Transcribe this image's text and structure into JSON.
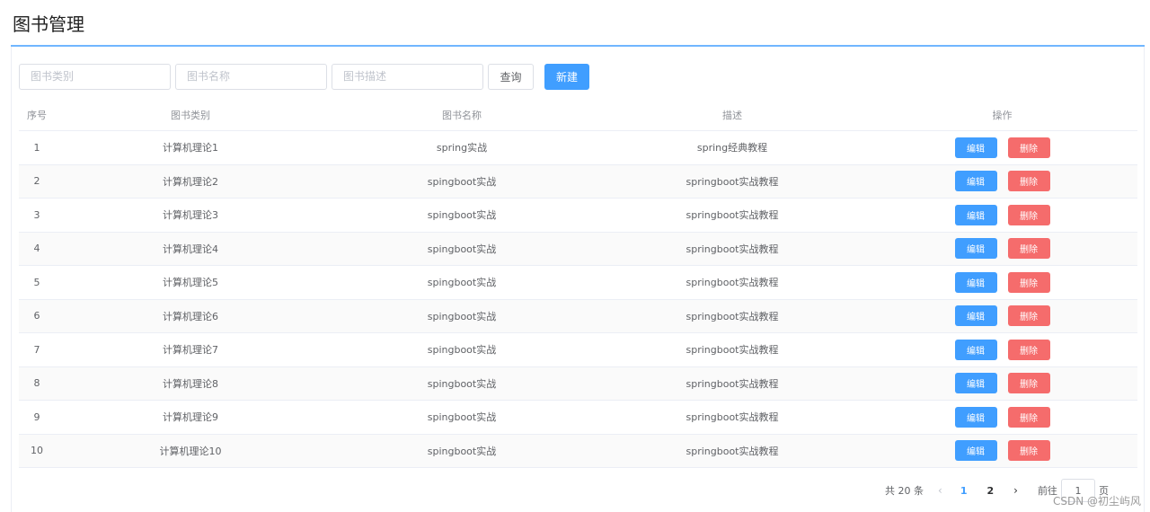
{
  "header": {
    "title": "图书管理"
  },
  "toolbar": {
    "category_placeholder": "图书类别",
    "name_placeholder": "图书名称",
    "desc_placeholder": "图书描述",
    "query_label": "查询",
    "new_label": "新建"
  },
  "table": {
    "columns": [
      "序号",
      "图书类别",
      "图书名称",
      "描述",
      "操作"
    ],
    "rows": [
      {
        "idx": "1",
        "category": "计算机理论1",
        "name": "spring实战",
        "desc": "spring经典教程",
        "edit": "编辑",
        "del": "删除"
      },
      {
        "idx": "2",
        "category": "计算机理论2",
        "name": "spingboot实战",
        "desc": "springboot实战教程",
        "edit": "编辑",
        "del": "删除"
      },
      {
        "idx": "3",
        "category": "计算机理论3",
        "name": "spingboot实战",
        "desc": "springboot实战教程",
        "edit": "编辑",
        "del": "删除"
      },
      {
        "idx": "4",
        "category": "计算机理论4",
        "name": "spingboot实战",
        "desc": "springboot实战教程",
        "edit": "编辑",
        "del": "删除"
      },
      {
        "idx": "5",
        "category": "计算机理论5",
        "name": "spingboot实战",
        "desc": "springboot实战教程",
        "edit": "编辑",
        "del": "删除"
      },
      {
        "idx": "6",
        "category": "计算机理论6",
        "name": "spingboot实战",
        "desc": "springboot实战教程",
        "edit": "编辑",
        "del": "删除"
      },
      {
        "idx": "7",
        "category": "计算机理论7",
        "name": "spingboot实战",
        "desc": "springboot实战教程",
        "edit": "编辑",
        "del": "删除"
      },
      {
        "idx": "8",
        "category": "计算机理论8",
        "name": "spingboot实战",
        "desc": "springboot实战教程",
        "edit": "编辑",
        "del": "删除"
      },
      {
        "idx": "9",
        "category": "计算机理论9",
        "name": "spingboot实战",
        "desc": "springboot实战教程",
        "edit": "编辑",
        "del": "删除"
      },
      {
        "idx": "10",
        "category": "计算机理论10",
        "name": "spingboot实战",
        "desc": "springboot实战教程",
        "edit": "编辑",
        "del": "删除"
      }
    ]
  },
  "pagination": {
    "total": "共 20 条",
    "prev_icon": "chevron-left-icon",
    "pages": [
      "1",
      "2"
    ],
    "active_page": "1",
    "next_icon": "chevron-right-icon",
    "goto_prefix": "前往",
    "goto_value": "1",
    "goto_suffix": "页"
  },
  "watermark": "CSDN @初尘屿风",
  "colors": {
    "primary": "#409eff",
    "danger": "#f56c6c",
    "border": "#ebeef5"
  }
}
